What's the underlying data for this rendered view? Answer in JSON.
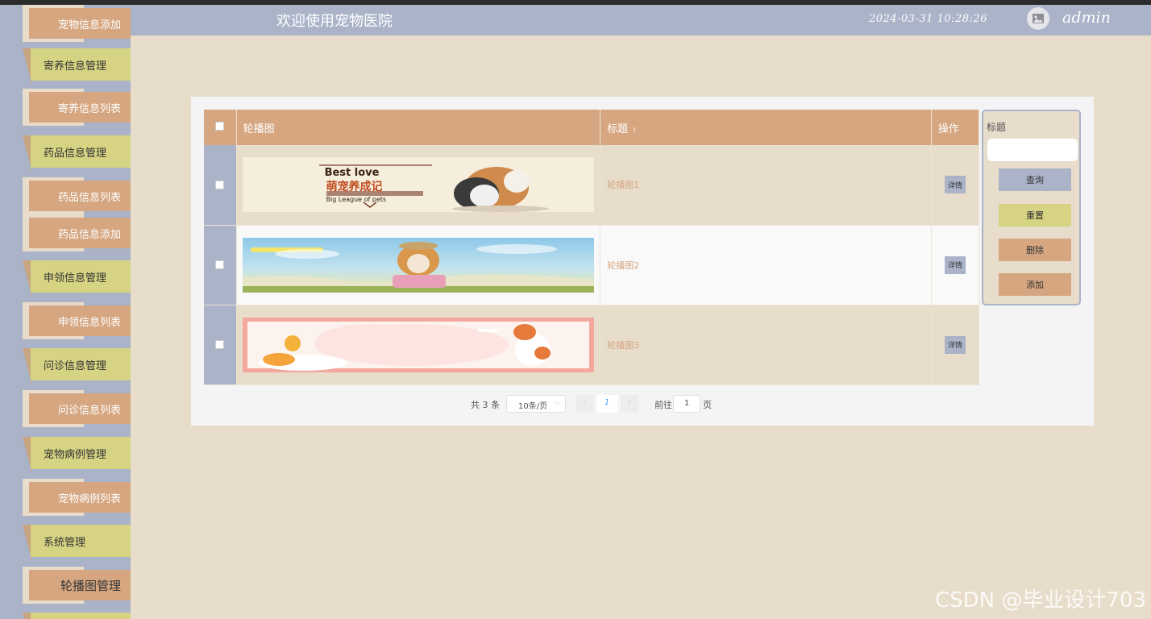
{
  "header": {
    "title": "欢迎使用宠物医院",
    "datetime": "2024-03-31 10:28:26",
    "username": "admin",
    "avatar_icon": "image-icon"
  },
  "sidebar": {
    "items": [
      {
        "label": "宠物信息添加",
        "kind": "sub"
      },
      {
        "label": "寄养信息管理",
        "kind": "main"
      },
      {
        "label": "寄养信息列表",
        "kind": "sub"
      },
      {
        "label": "药品信息管理",
        "kind": "main"
      },
      {
        "label": "药品信息列表",
        "kind": "sub"
      },
      {
        "label": "药品信息添加",
        "kind": "sub"
      },
      {
        "label": "申领信息管理",
        "kind": "main"
      },
      {
        "label": "申领信息列表",
        "kind": "sub"
      },
      {
        "label": "问诊信息管理",
        "kind": "main"
      },
      {
        "label": "问诊信息列表",
        "kind": "sub"
      },
      {
        "label": "宠物病例管理",
        "kind": "main"
      },
      {
        "label": "宠物病例列表",
        "kind": "sub"
      },
      {
        "label": "系统管理",
        "kind": "main"
      },
      {
        "label": "轮播图管理",
        "kind": "sub",
        "active": true
      }
    ]
  },
  "table": {
    "columns": {
      "image": "轮播图",
      "title": "标题",
      "action": "操作"
    },
    "rows": [
      {
        "title": "轮播图1",
        "action": "详情",
        "banner_text_1": "Best love",
        "banner_text_2": "萌宠养成记",
        "banner_text_3": "Big League of pets"
      },
      {
        "title": "轮播图2",
        "action": "详情"
      },
      {
        "title": "轮播图3",
        "action": "详情"
      }
    ]
  },
  "search": {
    "label": "标题",
    "value": "",
    "buttons": {
      "query": "查询",
      "reset": "重置",
      "delete": "删除",
      "add": "添加"
    }
  },
  "pagination": {
    "total": "共 3 条",
    "page_size": "10条/页",
    "current_page": "1",
    "goto_label": "前往",
    "goto_value": "1",
    "page_unit": "页"
  },
  "watermark": "CSDN @毕业设计703",
  "colors": {
    "bg": "#e8dccb",
    "slate": "#aab3c8",
    "tan": "#d5a680",
    "olive": "#d6d382"
  }
}
